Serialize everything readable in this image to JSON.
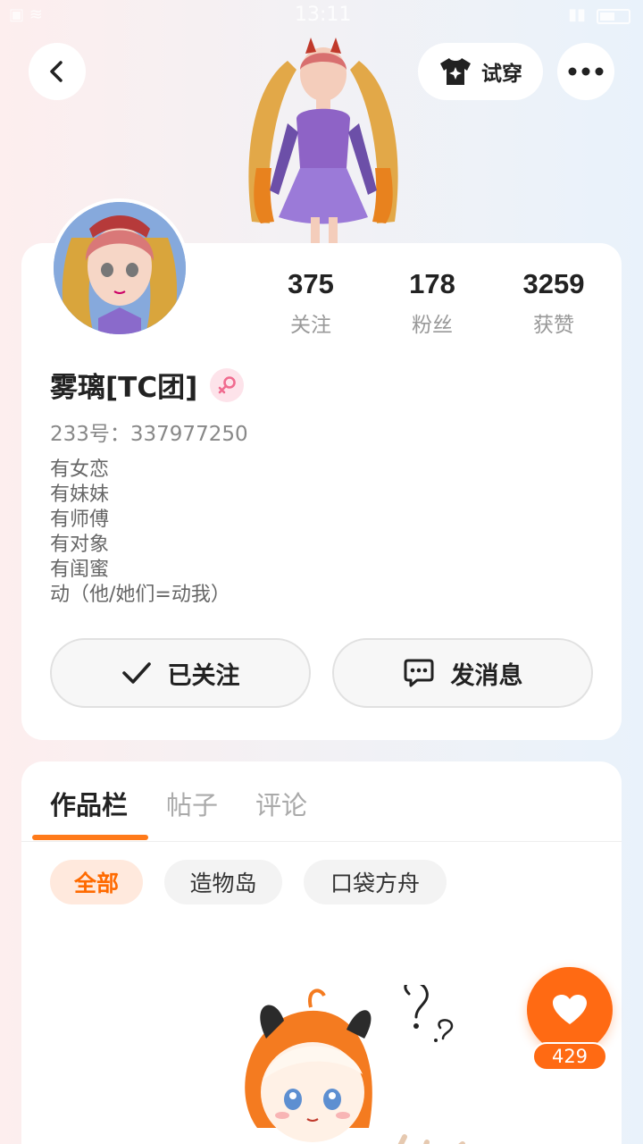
{
  "status_bar": {
    "time": "13:11"
  },
  "header": {
    "back_icon": "chevron-left-icon",
    "tryon_label": "试穿",
    "tryon_icon": "shirt-sparkle-icon",
    "more_icon": "more-dots-icon"
  },
  "profile": {
    "name": "雾璃[TC团]",
    "gender_icon": "female-symbol-icon",
    "uid_line": "233号：337977250",
    "stats": [
      {
        "value": "375",
        "label": "关注"
      },
      {
        "value": "178",
        "label": "粉丝"
      },
      {
        "value": "3259",
        "label": "获赞"
      }
    ],
    "bio": [
      "有女恋",
      "有妹妹",
      "有师傅",
      "有对象",
      "有闺蜜",
      "动（他/她们=动我）"
    ],
    "follow_label": "已关注",
    "message_label": "发消息"
  },
  "tabs": [
    {
      "label": "作品栏",
      "active": true
    },
    {
      "label": "帖子",
      "active": false
    },
    {
      "label": "评论",
      "active": false
    }
  ],
  "chips": [
    {
      "label": "全部",
      "active": true
    },
    {
      "label": "造物岛",
      "active": false
    },
    {
      "label": "口袋方舟",
      "active": false
    }
  ],
  "like": {
    "count": "429"
  },
  "colors": {
    "accent": "#ff6a13",
    "accent_soft": "#ffe9dd",
    "female": "#f06b8f"
  }
}
